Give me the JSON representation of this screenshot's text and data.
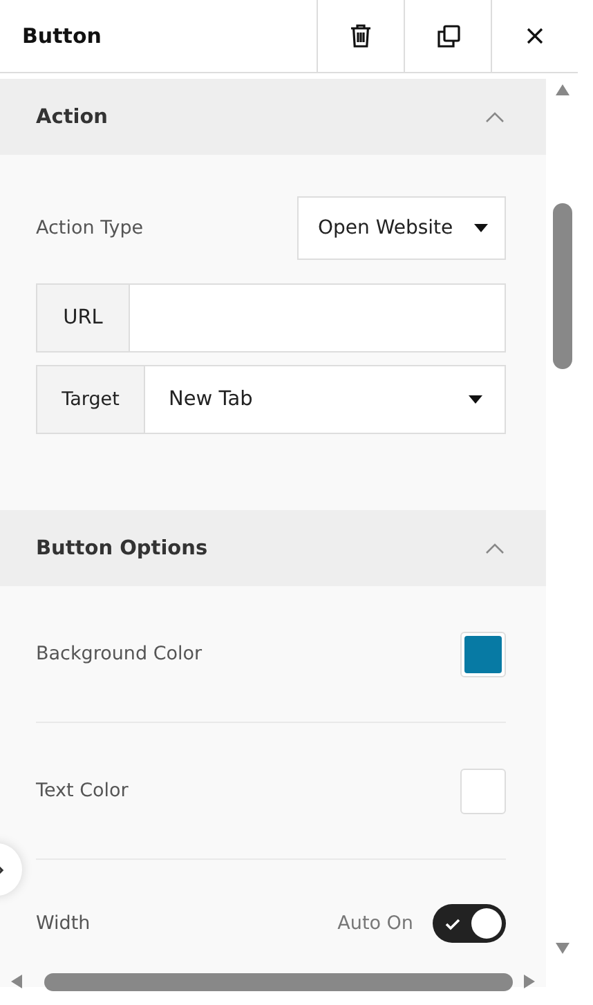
{
  "header": {
    "title": "Button"
  },
  "sections": [
    {
      "kind": "action",
      "title": "Action",
      "expanded": true,
      "action_type": {
        "label": "Action Type",
        "value": "Open Website"
      },
      "url": {
        "label": "URL"
      },
      "target": {
        "label": "Target",
        "value": "New Tab"
      }
    },
    {
      "kind": "options",
      "title": "Button Options",
      "expanded": true,
      "rows": [
        {
          "kind": "color",
          "label": "Background Color",
          "color": "#077aa4"
        },
        {
          "kind": "color",
          "label": "Text Color",
          "color": "#ffffff"
        },
        {
          "kind": "toggle",
          "label": "Width",
          "caption": "Auto On",
          "on": true
        }
      ]
    }
  ]
}
